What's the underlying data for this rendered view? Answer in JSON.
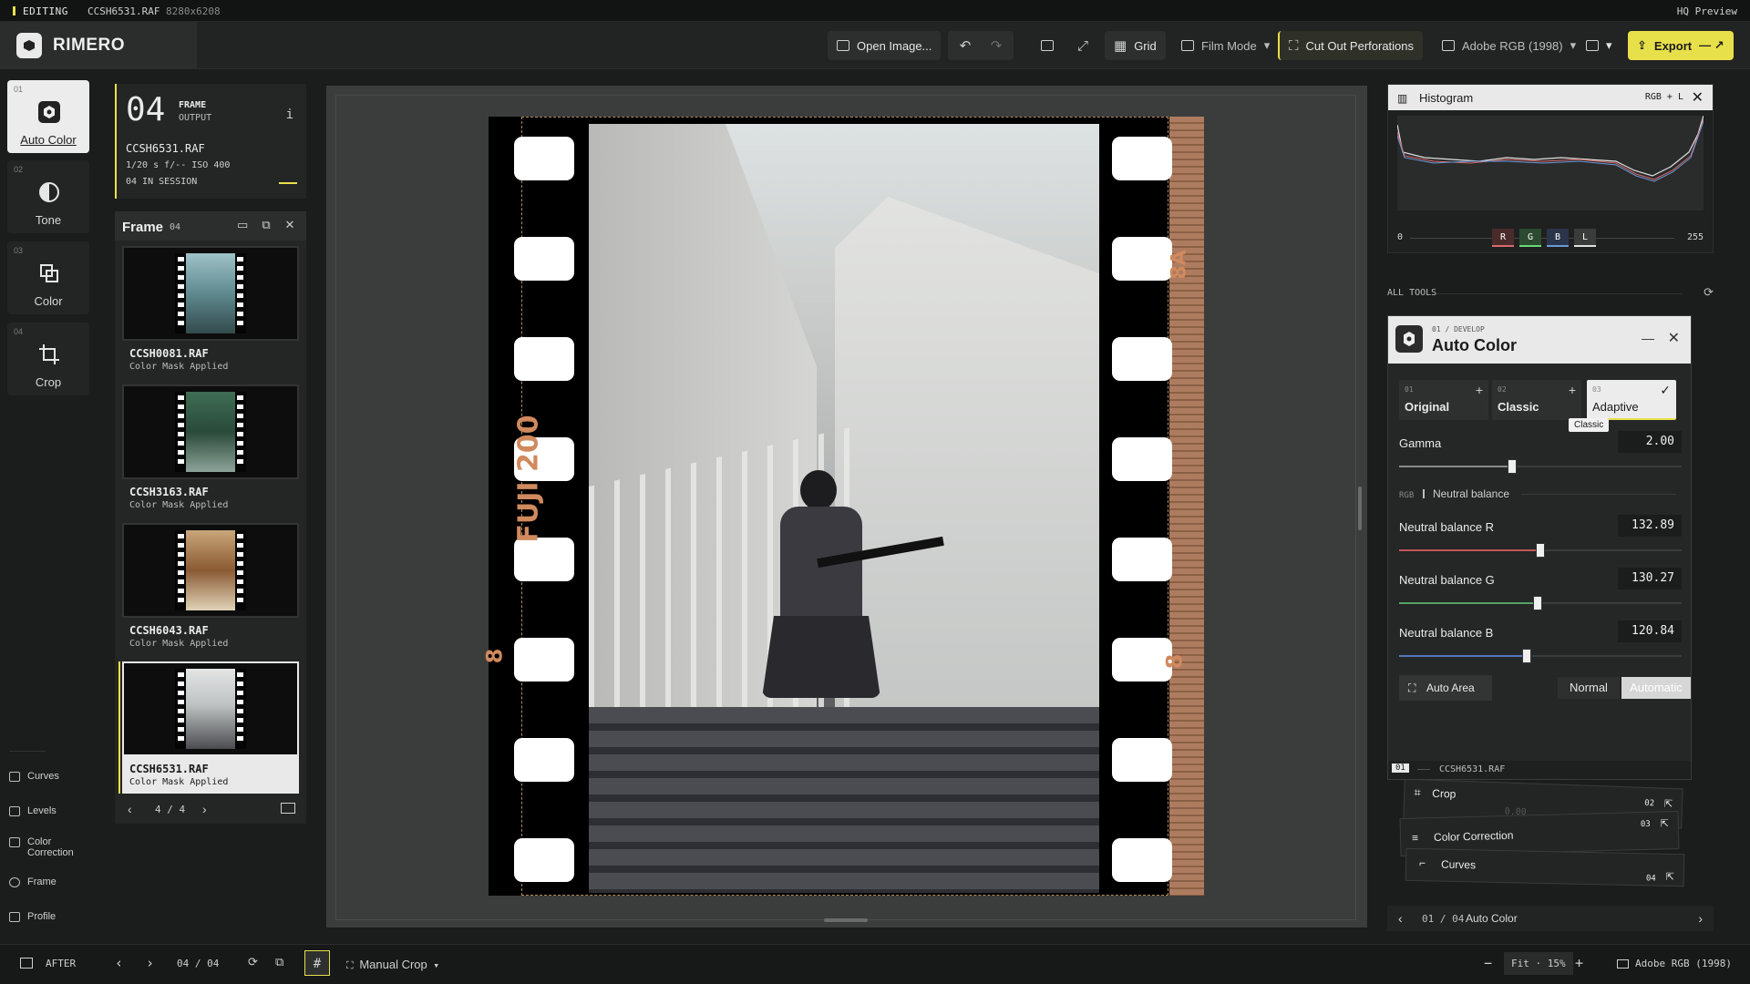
{
  "status": {
    "mode": "EDITING",
    "filename": "CCSH6531.RAF",
    "dimensions": "8280x6208",
    "preview": "HQ Preview"
  },
  "app": {
    "name": "RIMERO"
  },
  "toolbar": {
    "open_image": "Open Image...",
    "grid": "Grid",
    "film_mode": "Film Mode",
    "cut_out": "Cut Out Perforations",
    "color_space": "Adobe RGB (1998)",
    "export": "Export"
  },
  "rail": [
    {
      "num": "01",
      "label": "Auto Color",
      "icon": "auto-color-icon"
    },
    {
      "num": "02",
      "label": "Tone",
      "icon": "tone-icon"
    },
    {
      "num": "03",
      "label": "Color",
      "icon": "color-icon"
    },
    {
      "num": "04",
      "label": "Crop",
      "icon": "crop-icon"
    }
  ],
  "lower_tools": [
    "Curves",
    "Levels",
    "Color Correction",
    "Frame",
    "Profile"
  ],
  "frame_info": {
    "number": "04",
    "title": "FRAME",
    "subtitle": "OUTPUT",
    "info": "i",
    "filename": "CCSH6531.RAF",
    "exposure": "1/20 s f/-- ISO 400",
    "session": "04 IN SESSION"
  },
  "film_panel": {
    "title": "Frame",
    "count": "04",
    "items": [
      {
        "name": "CCSH0081.RAF",
        "status": "Color Mask Applied"
      },
      {
        "name": "CCSH3163.RAF",
        "status": "Color Mask Applied"
      },
      {
        "name": "CCSH6043.RAF",
        "status": "Color Mask Applied"
      },
      {
        "name": "CCSH6531.RAF",
        "status": "Color Mask Applied"
      }
    ],
    "pager": "4 / 4"
  },
  "film_text": {
    "brand": "FUJI 200",
    "frame_top": "8A",
    "frame_bottom_left": "8",
    "frame_bottom_right": "8"
  },
  "histogram": {
    "title": "Histogram",
    "mode": "RGB + L",
    "min": "0",
    "max": "255",
    "channels": [
      "R",
      "G",
      "B",
      "L"
    ]
  },
  "all_tools": "ALL TOOLS",
  "auto_color": {
    "breadcrumb": "01 / DEVELOP",
    "title": "Auto Color",
    "presets": [
      {
        "num": "01",
        "label": "Original",
        "mark": "+"
      },
      {
        "num": "02",
        "label": "Classic",
        "mark": "+"
      },
      {
        "num": "03",
        "label": "Adaptive",
        "mark": "✓"
      }
    ],
    "tooltip": "Classic",
    "gamma": {
      "label": "Gamma",
      "value": "2.00",
      "level": 0.4
    },
    "section_prefix": "RGB",
    "section": "Neutral balance",
    "nb_r": {
      "label": "Neutral balance R",
      "value": "132.89",
      "level": 0.5
    },
    "nb_g": {
      "label": "Neutral balance G",
      "value": "130.27",
      "level": 0.49
    },
    "nb_b": {
      "label": "Neutral balance B",
      "value": "120.84",
      "level": 0.45
    },
    "auto_area": "Auto Area",
    "normal": "Normal",
    "automatic": "Automatic",
    "footer_num": "01",
    "footer_file": "CCSH6531.RAF"
  },
  "stack": [
    {
      "label": "Crop",
      "num": "02"
    },
    {
      "label": "Color Correction",
      "num": "03"
    },
    {
      "label": "Curves",
      "num": "04"
    }
  ],
  "stack_ghost_value": "0.00",
  "tool_nav": {
    "position": "01 / 04",
    "label": "Auto Color"
  },
  "bottom": {
    "after": "AFTER",
    "page": "04 / 04",
    "manual_crop": "Manual Crop",
    "zoom": "Fit · 15%",
    "color_space": "Adobe RGB (1998)"
  },
  "colors": {
    "accent": "#e8e04a",
    "panel": "#242525",
    "canvas": "#3b3c3c"
  }
}
